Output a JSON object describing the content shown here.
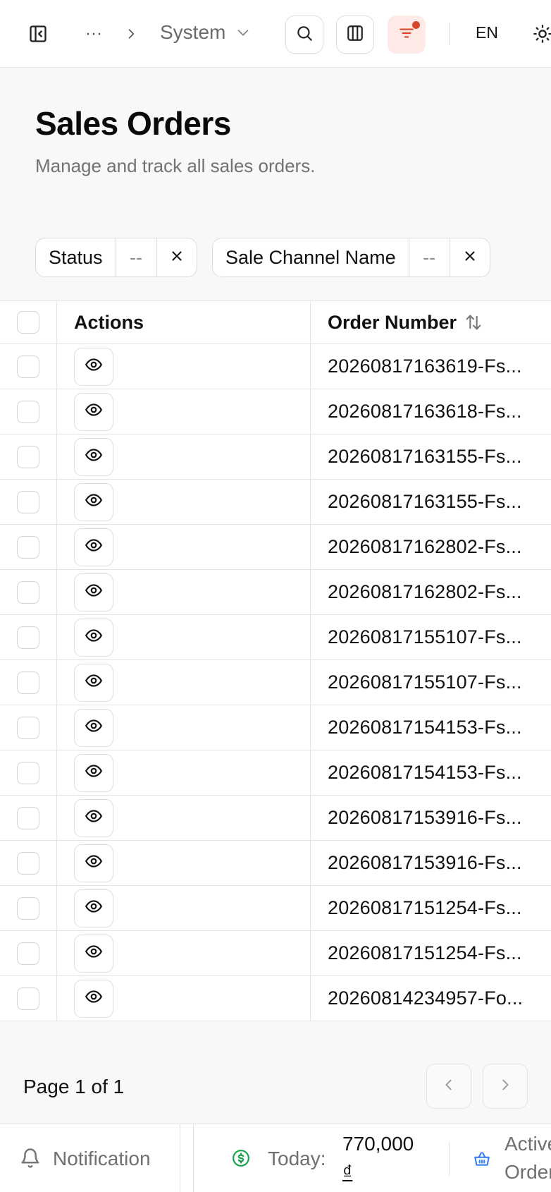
{
  "topbar": {
    "breadcrumb_ellipsis": "···",
    "breadcrumb_current": "System",
    "language": "EN"
  },
  "header": {
    "title": "Sales Orders",
    "subtitle": "Manage and track all sales orders."
  },
  "filters": [
    {
      "label": "Status",
      "value": "--"
    },
    {
      "label": "Sale Channel Name",
      "value": "--"
    }
  ],
  "table": {
    "columns": {
      "actions": "Actions",
      "order_number": "Order Number"
    },
    "rows": [
      "20260817163619-Fs...",
      "20260817163618-Fs...",
      "20260817163155-Fs...",
      "20260817163155-Fs...",
      "20260817162802-Fs...",
      "20260817162802-Fs...",
      "20260817155107-Fs...",
      "20260817155107-Fs...",
      "20260817154153-Fs...",
      "20260817154153-Fs...",
      "20260817153916-Fs...",
      "20260817153916-Fs...",
      "20260817151254-Fs...",
      "20260817151254-Fs...",
      "20260814234957-Fo..."
    ]
  },
  "pagination": {
    "label": "Page 1 of 1"
  },
  "bottombar": {
    "notification": "Notification",
    "today_label": "Today:",
    "today_value_line1": "770,000",
    "today_value_line2": "₫",
    "active_orders_line1": "Active",
    "active_orders_line2": "Orders"
  },
  "colors": {
    "accent": "#d9472b",
    "accent_bg": "#fde9e5",
    "money_icon": "#16a34a",
    "basket_icon": "#3b82f6"
  }
}
